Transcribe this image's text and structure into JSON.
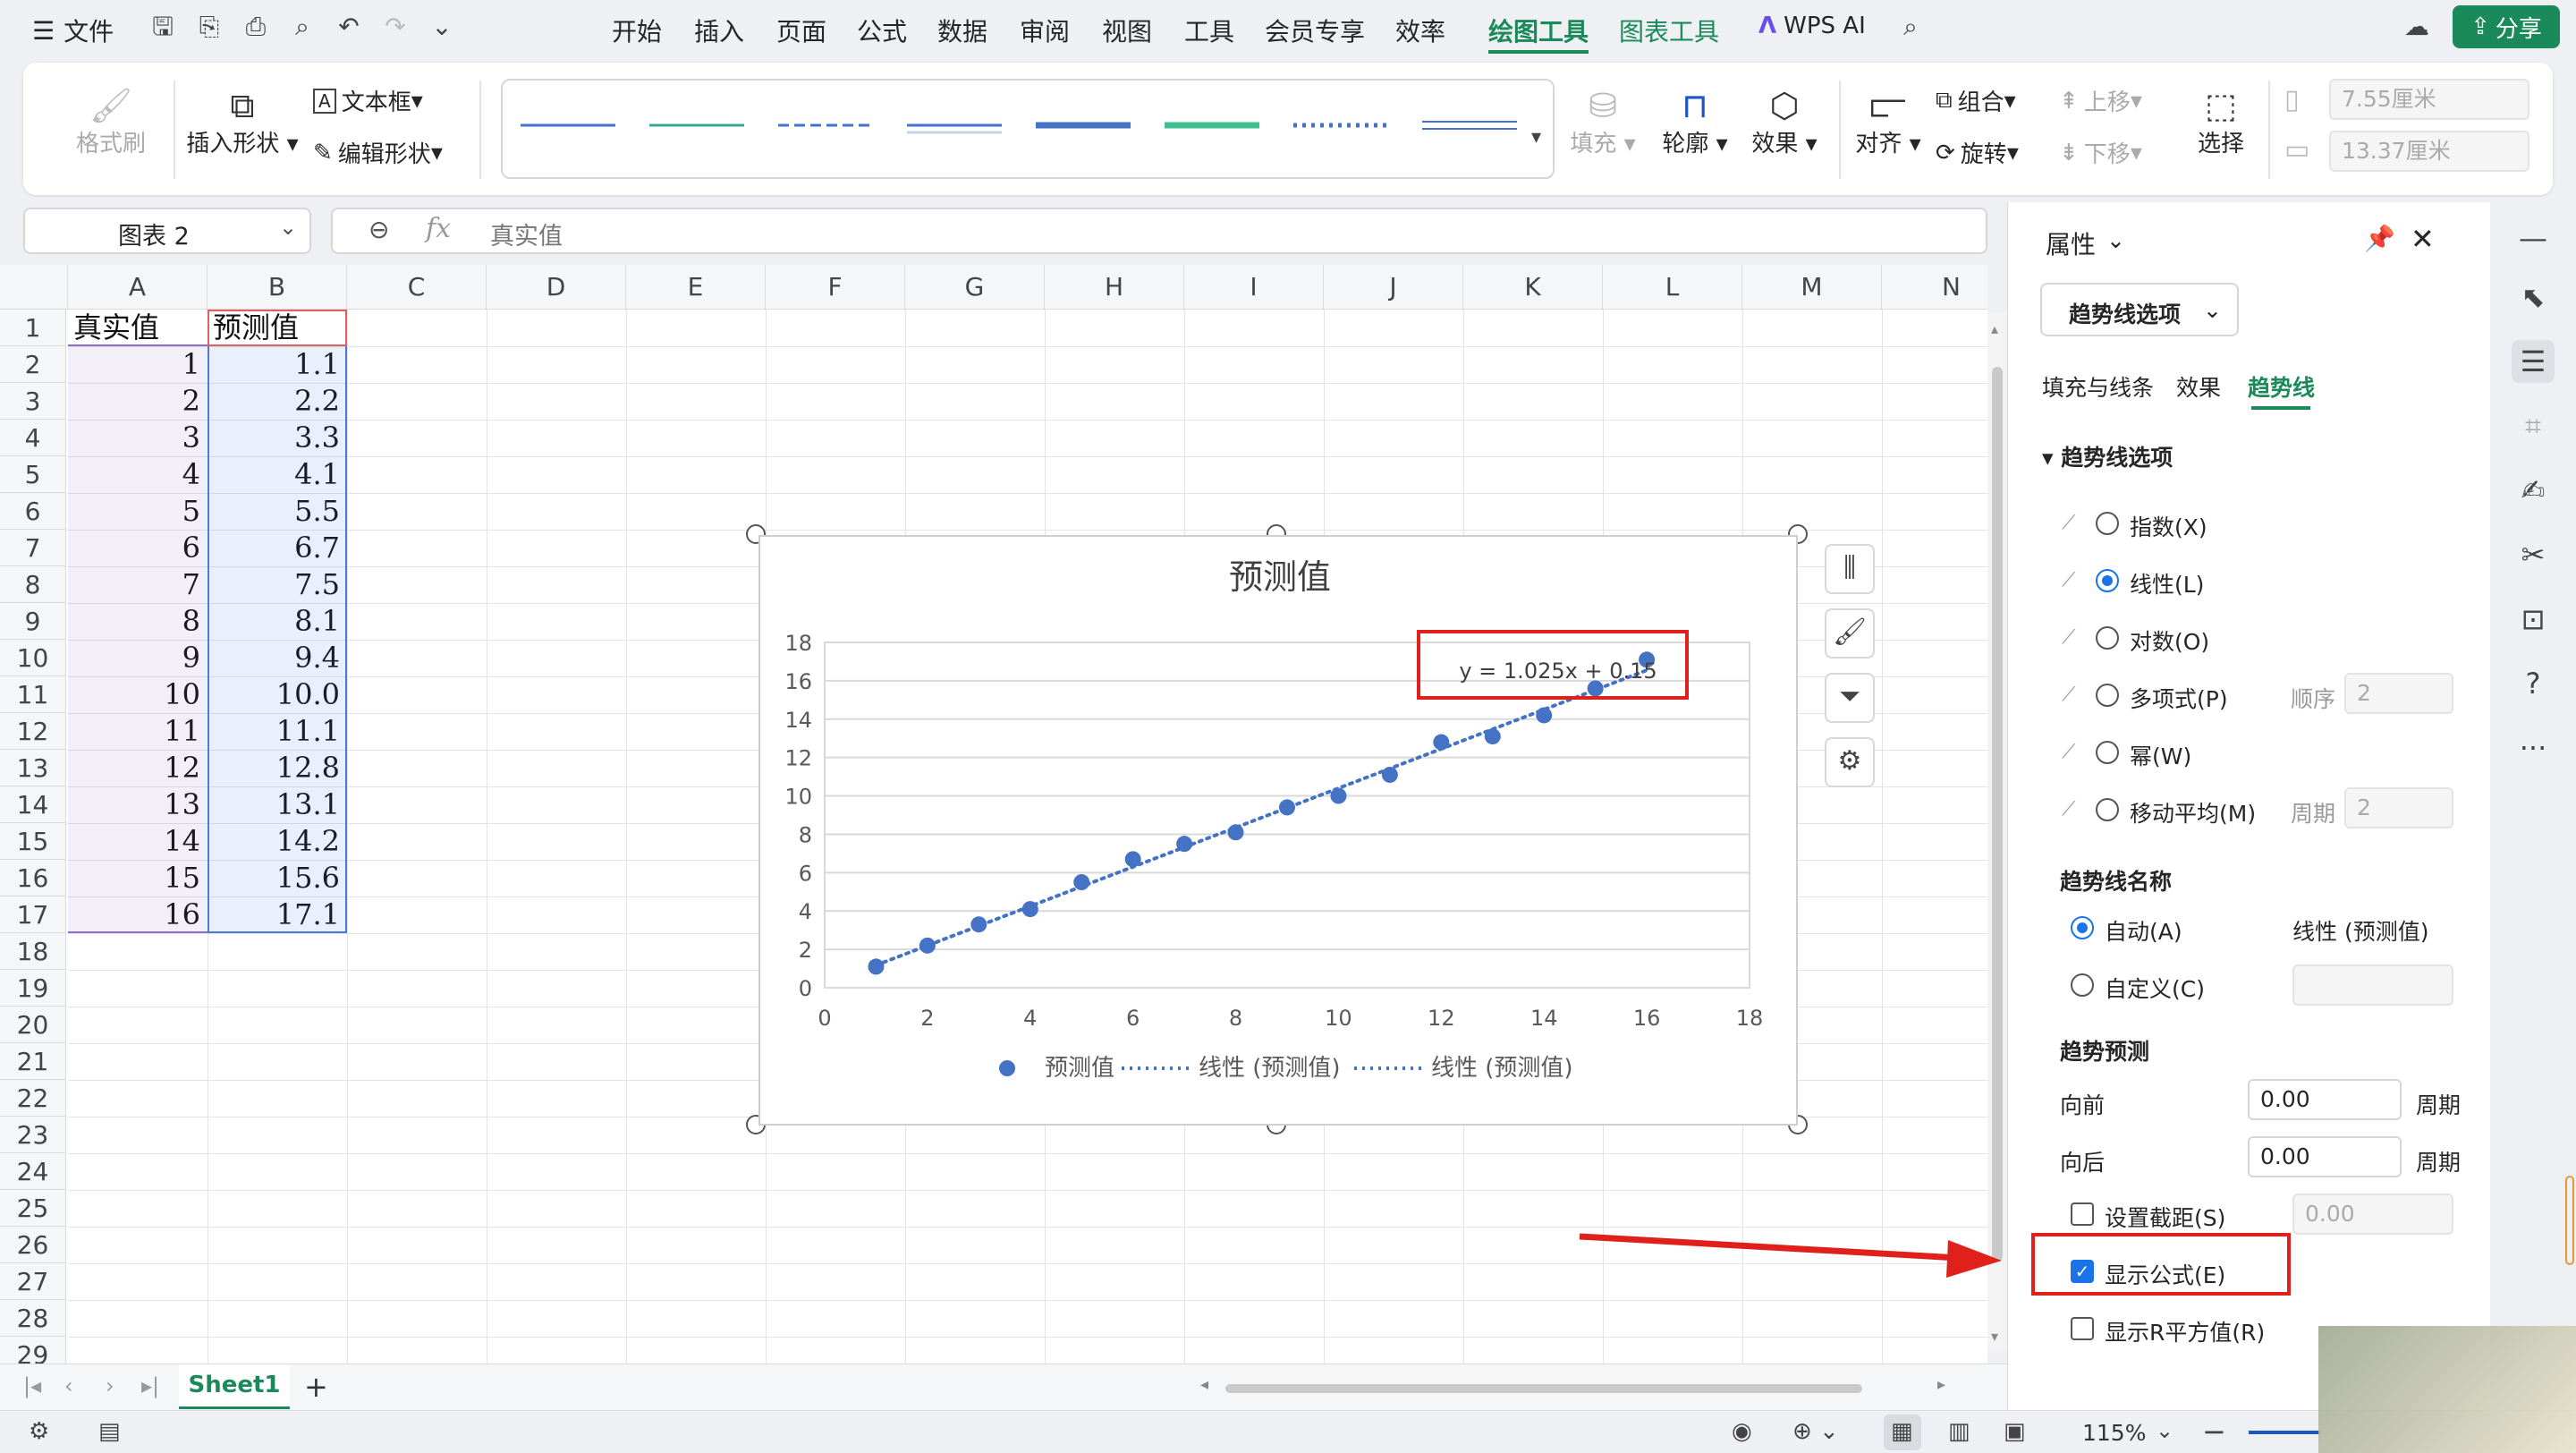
{
  "title_bar": {
    "file_menu": "文件",
    "menus": [
      "开始",
      "插入",
      "页面",
      "公式",
      "数据",
      "审阅",
      "视图",
      "工具",
      "会员专享",
      "效率",
      "绘图工具",
      "图表工具"
    ],
    "active_menu": "绘图工具",
    "wps_ai": "WPS AI",
    "share": "分享"
  },
  "ribbon": {
    "format_painter": "格式刷",
    "insert_shape": "插入形状",
    "text_box": "文本框",
    "edit_shape": "编辑形状",
    "fill": "填充",
    "outline": "轮廓",
    "effects": "效果",
    "align": "对齐",
    "group": "组合",
    "rotate": "旋转",
    "bring_forward": "上移",
    "send_backward": "下移",
    "select": "选择",
    "width_value": "7.55厘米",
    "height_value": "13.37厘米"
  },
  "formula_bar": {
    "name_box": "图表 2",
    "fx": "fx",
    "content": "真实值"
  },
  "sheet": {
    "columns": [
      "A",
      "B",
      "C",
      "D",
      "E",
      "F",
      "G",
      "H",
      "I",
      "J",
      "K",
      "L",
      "M",
      "N"
    ],
    "rows": [
      "1",
      "2",
      "3",
      "4",
      "5",
      "6",
      "7",
      "8",
      "9",
      "10",
      "11",
      "12",
      "13",
      "14",
      "15",
      "16",
      "17",
      "18",
      "19",
      "20",
      "21",
      "22",
      "23",
      "24",
      "25",
      "26",
      "27",
      "28",
      "29"
    ],
    "headers": [
      "真实值",
      "预测值"
    ],
    "actual": [
      "1",
      "2",
      "3",
      "4",
      "5",
      "6",
      "7",
      "8",
      "9",
      "10",
      "11",
      "12",
      "13",
      "14",
      "15",
      "16"
    ],
    "predicted": [
      "1.1",
      "2.2",
      "3.3",
      "4.1",
      "5.5",
      "6.7",
      "7.5",
      "8.1",
      "9.4",
      "10.0",
      "11.1",
      "12.8",
      "13.1",
      "14.2",
      "15.6",
      "17.1"
    ],
    "tab": "Sheet1"
  },
  "chart_data": {
    "type": "scatter",
    "title": "预测值",
    "x": [
      1,
      2,
      3,
      4,
      5,
      6,
      7,
      8,
      9,
      10,
      11,
      12,
      13,
      14,
      15,
      16
    ],
    "series": [
      {
        "name": "预测值",
        "values": [
          1.1,
          2.2,
          3.3,
          4.1,
          5.5,
          6.7,
          7.5,
          8.1,
          9.4,
          10.0,
          11.1,
          12.8,
          13.1,
          14.2,
          15.6,
          17.1
        ]
      }
    ],
    "trendline": {
      "type": "linear",
      "slope": 1.025,
      "intercept": 0.15,
      "equation": "y = 1.025x + 0.15"
    },
    "legend": [
      "预测值",
      "线性 (预测值)",
      "线性 (预测值)"
    ],
    "legend_position": "bottom",
    "xlim": [
      0,
      18
    ],
    "ylim": [
      0,
      18
    ],
    "xticks": [
      "0",
      "2",
      "4",
      "6",
      "8",
      "10",
      "12",
      "14",
      "16",
      "18"
    ],
    "yticks": [
      "0",
      "2",
      "4",
      "6",
      "8",
      "10",
      "12",
      "14",
      "16",
      "18"
    ],
    "grid": true,
    "point_color": "#4472c4"
  },
  "panel": {
    "title": "属性",
    "dropdown": "趋势线选项",
    "tabs": [
      "填充与线条",
      "效果",
      "趋势线"
    ],
    "active_tab": "趋势线",
    "section_options": "趋势线选项",
    "types": [
      "指数(X)",
      "线性(L)",
      "对数(O)",
      "多项式(P)",
      "幂(W)",
      "移动平均(M)"
    ],
    "selected_type": "线性(L)",
    "order_label": "顺序",
    "order_value": "2",
    "period_label": "周期",
    "period_value": "2",
    "name_section": "趋势线名称",
    "auto_label": "自动(A)",
    "auto_value": "线性 (预测值)",
    "custom_label": "自定义(C)",
    "forecast_section": "趋势预测",
    "forward_label": "向前",
    "forward_value": "0.00",
    "backward_label": "向后",
    "backward_value": "0.00",
    "unit": "周期",
    "intercept_label": "设置截距(S)",
    "intercept_value": "0.00",
    "show_equation_label": "显示公式(E)",
    "show_r2_label": "显示R平方值(R)"
  },
  "status": {
    "zoom": "115%"
  },
  "colors": {
    "accent": "#1b8a5a",
    "selection_blue": "#1a73e8",
    "annotation_red": "#e0201b"
  }
}
